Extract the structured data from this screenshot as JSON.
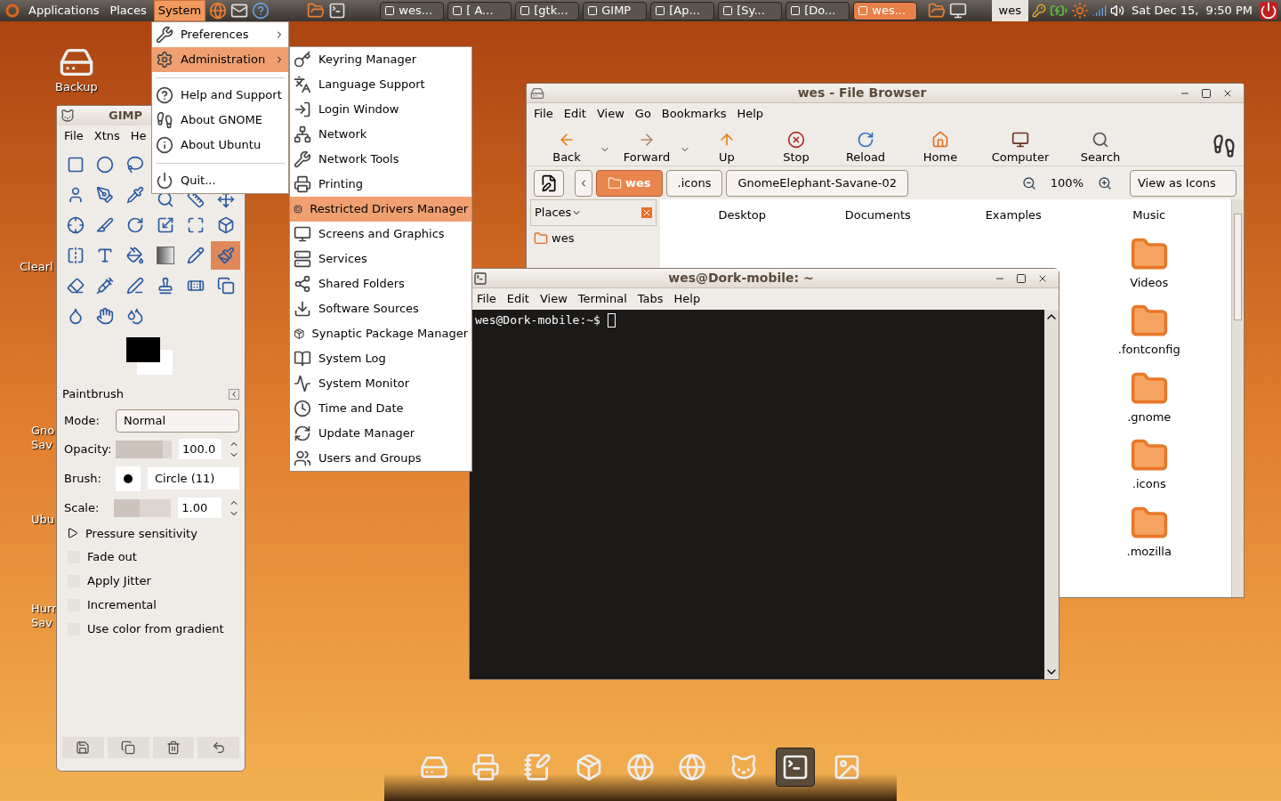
{
  "top_panel": {
    "menus": [
      {
        "label": "Applications",
        "selected": false
      },
      {
        "label": "Places",
        "selected": false
      },
      {
        "label": "System",
        "selected": true
      }
    ],
    "tasks": [
      {
        "label": "wes...",
        "selected": false
      },
      {
        "label": "[ A...",
        "selected": false
      },
      {
        "label": "[gtk...",
        "selected": false
      },
      {
        "label": "GIMP",
        "selected": false
      },
      {
        "label": "[Ap...",
        "selected": false
      },
      {
        "label": "[Sy...",
        "selected": false
      },
      {
        "label": "[Do...",
        "selected": false
      },
      {
        "label": "wes...",
        "selected": true
      }
    ],
    "user": "wes",
    "clock": "Sat Dec 15,  9:50 PM"
  },
  "desktop_icons": [
    {
      "lines": [
        "Backup"
      ],
      "kind": "drive"
    },
    {
      "lines": [
        "Clearl"
      ],
      "kind": "label"
    },
    {
      "lines": [
        "Gno",
        "Sav"
      ],
      "kind": "label"
    },
    {
      "lines": [
        "Ubu"
      ],
      "kind": "label"
    },
    {
      "lines": [
        "Hurr",
        "Sav"
      ],
      "kind": "label"
    }
  ],
  "system_menu": [
    {
      "kind": "submenu",
      "label": "Preferences",
      "selected": false
    },
    {
      "kind": "submenu",
      "label": "Administration",
      "selected": true
    },
    {
      "kind": "separator"
    },
    {
      "kind": "item",
      "label": "Help and Support",
      "selected": false
    },
    {
      "kind": "item",
      "label": "About GNOME",
      "selected": false
    },
    {
      "kind": "item",
      "label": "About Ubuntu",
      "selected": false
    },
    {
      "kind": "separator"
    },
    {
      "kind": "item",
      "label": "Quit...",
      "selected": false
    }
  ],
  "administration_menu": [
    {
      "label": "Keyring Manager",
      "selected": false
    },
    {
      "label": "Language Support",
      "selected": false
    },
    {
      "label": "Login Window",
      "selected": false
    },
    {
      "label": "Network",
      "selected": false
    },
    {
      "label": "Network Tools",
      "selected": false
    },
    {
      "label": "Printing",
      "selected": false
    },
    {
      "label": "Restricted Drivers Manager",
      "selected": true
    },
    {
      "label": "Screens and Graphics",
      "selected": false
    },
    {
      "label": "Services",
      "selected": false
    },
    {
      "label": "Shared Folders",
      "selected": false
    },
    {
      "label": "Software Sources",
      "selected": false
    },
    {
      "label": "Synaptic Package Manager",
      "selected": false
    },
    {
      "label": "System Log",
      "selected": false
    },
    {
      "label": "System Monitor",
      "selected": false
    },
    {
      "label": "Time and Date",
      "selected": false
    },
    {
      "label": "Update Manager",
      "selected": false
    },
    {
      "label": "Users and Groups",
      "selected": false
    }
  ],
  "file_browser": {
    "title": "wes - File Browser",
    "menus": [
      "File",
      "Edit",
      "View",
      "Go",
      "Bookmarks",
      "Help"
    ],
    "toolbar": [
      {
        "label": "Back",
        "menu": true
      },
      {
        "label": "Forward",
        "menu": true
      },
      {
        "label": "Up",
        "menu": false
      },
      {
        "label": "Stop",
        "menu": false
      },
      {
        "label": "Reload",
        "menu": false
      },
      {
        "label": "Home",
        "menu": false
      },
      {
        "label": "Computer",
        "menu": false
      },
      {
        "label": "Search",
        "menu": false
      }
    ],
    "path": [
      {
        "label": "wes",
        "selected": true
      },
      {
        "label": ".icons",
        "selected": false
      },
      {
        "label": "GnomeElephant-Savane-02",
        "selected": false
      }
    ],
    "zoom": "100%",
    "view": "View as Icons",
    "side_pane": {
      "title": "Places",
      "items": [
        "wes"
      ]
    },
    "icons": [
      {
        "label": "Desktop"
      },
      {
        "label": "Documents"
      },
      {
        "label": "Examples"
      },
      {
        "label": "Music"
      },
      {
        "label": "Videos"
      },
      {
        "label": ".fontconfig"
      },
      {
        "label": ".gnome"
      },
      {
        "label": ".icons"
      },
      {
        "label": ".mozilla"
      }
    ]
  },
  "terminal": {
    "title": "wes@Dork-mobile: ~",
    "menus": [
      "File",
      "Edit",
      "View",
      "Terminal",
      "Tabs",
      "Help"
    ],
    "prompt": "wes@Dork-mobile:~$"
  },
  "gimp": {
    "title": "GIMP",
    "menus": [
      "File",
      "Xtns",
      "He"
    ],
    "tools": [
      {
        "selected": false
      },
      {
        "selected": false
      },
      {
        "selected": false
      },
      {
        "selected": false
      },
      {
        "selected": false
      },
      {
        "selected": false
      },
      {
        "selected": false
      },
      {
        "selected": false
      },
      {
        "selected": false
      },
      {
        "selected": false
      },
      {
        "selected": false
      },
      {
        "selected": false
      },
      {
        "selected": false
      },
      {
        "selected": false
      },
      {
        "selected": false
      },
      {
        "selected": false
      },
      {
        "selected": false
      },
      {
        "selected": false
      },
      {
        "selected": false
      },
      {
        "selected": false
      },
      {
        "selected": true
      },
      {
        "selected": false
      },
      {
        "selected": false
      },
      {
        "selected": false
      },
      {
        "selected": false
      },
      {
        "selected": false
      },
      {
        "selected": false
      },
      {
        "selected": false
      },
      {
        "selected": false
      },
      {
        "selected": false
      }
    ],
    "options_title": "Paintbrush",
    "mode_label": "Mode:",
    "mode": "Normal",
    "opacity": {
      "label": "Opacity:",
      "value": "100.0",
      "level": 0.85
    },
    "brush_label": "Brush:",
    "brush": "Circle (11)",
    "scale": {
      "label": "Scale:",
      "value": "1.00",
      "level": 0.45
    },
    "pressure": {
      "label": "Pressure sensitivity",
      "expanded": false
    },
    "checks": [
      {
        "label": "Fade out",
        "checked": false
      },
      {
        "label": "Apply Jitter",
        "checked": false
      },
      {
        "label": "Incremental",
        "checked": false
      },
      {
        "label": "Use color from gradient",
        "checked": false
      }
    ]
  },
  "dock": [
    {
      "selected": false
    },
    {
      "selected": false
    },
    {
      "selected": false
    },
    {
      "selected": false
    },
    {
      "selected": false
    },
    {
      "selected": false
    },
    {
      "selected": false
    },
    {
      "selected": true
    },
    {
      "selected": false
    }
  ]
}
